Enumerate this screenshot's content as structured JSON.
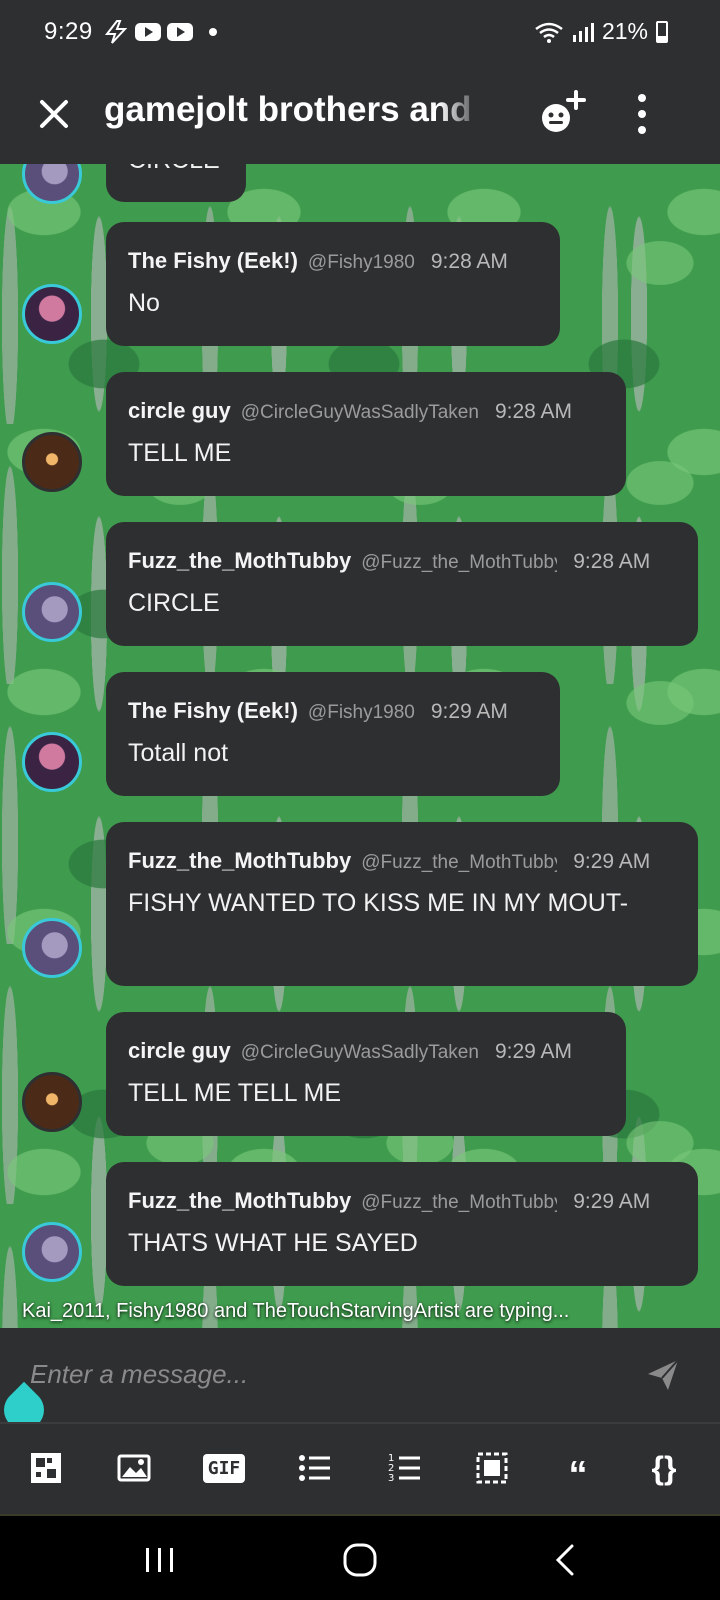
{
  "status_bar": {
    "time": "9:29",
    "battery": "21%"
  },
  "header": {
    "title": "gamejolt brothers and sisters"
  },
  "partial_message": {
    "text": "CIRCLE"
  },
  "messages": [
    {
      "author": "The Fishy (Eek!)",
      "handle": "@Fishy1980",
      "time": "9:28 AM",
      "text": "No"
    },
    {
      "author": "circle guy",
      "handle": "@CircleGuyWasSadlyTaken",
      "time": "9:28 AM",
      "text": "TELL ME"
    },
    {
      "author": "Fuzz_the_MothTubby",
      "handle": "@Fuzz_the_MothTubby",
      "time": "9:28 AM",
      "text": "CIRCLE"
    },
    {
      "author": "The Fishy (Eek!)",
      "handle": "@Fishy1980",
      "time": "9:29 AM",
      "text": "Totall not"
    },
    {
      "author": "Fuzz_the_MothTubby",
      "handle": "@Fuzz_the_MothTubby",
      "time": "9:29 AM",
      "text": "FISHY WANTED TO KISS ME IN MY MOUT-"
    },
    {
      "author": "circle guy",
      "handle": "@CircleGuyWasSadlyTaken",
      "time": "9:29 AM",
      "text": "TELL ME TELL ME"
    },
    {
      "author": "Fuzz_the_MothTubby",
      "handle": "@Fuzz_the_MothTubby",
      "time": "9:29 AM",
      "text": "THATS WHAT HE SAYED"
    }
  ],
  "typing_indicator": "Kai_2011, Fishy1980 and TheTouchStarvingArtist are typing...",
  "composer": {
    "placeholder": "Enter a message..."
  },
  "toolbar": {
    "gif_label": "GIF",
    "quote_label": "“",
    "code_label": "{}"
  }
}
